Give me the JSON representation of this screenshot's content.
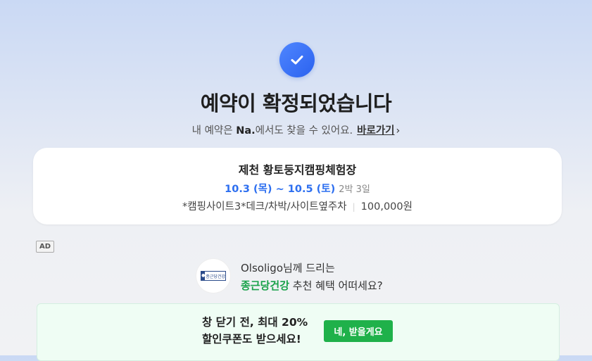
{
  "icons": {
    "check": "check-icon"
  },
  "colors": {
    "accent_blue": "#2d6ff0",
    "brand_green": "#1aa24a",
    "button_green": "#1fb14a"
  },
  "header": {
    "title": "예약이 확정되었습니다",
    "subtitle_prefix": "내 예약은 ",
    "subtitle_brand": "Na.",
    "subtitle_suffix": "에서도 찾을 수 있어요.",
    "link_label": "바로가기",
    "link_chevron": "›"
  },
  "reservation": {
    "campsite_name": "제천 황토둥지캠핑체험장",
    "dates": "10.3 (목) ~ 10.5 (토)",
    "nights": "2박 3일",
    "site": "*캠핑사이트3*데크/차박/사이트옆주차",
    "price": "100,000원"
  },
  "ad": {
    "badge": "AD",
    "logo_text": "종근당건강",
    "line1": "Olsoligo님께 드리는",
    "brand": "종근당건강",
    "line2_suffix": " 추천 혜택 어떠세요?"
  },
  "coupon": {
    "line1": "창 닫기 전, 최대 20%",
    "line2": "할인쿠폰도 받으세요!",
    "button_label": "네, 받을게요"
  }
}
